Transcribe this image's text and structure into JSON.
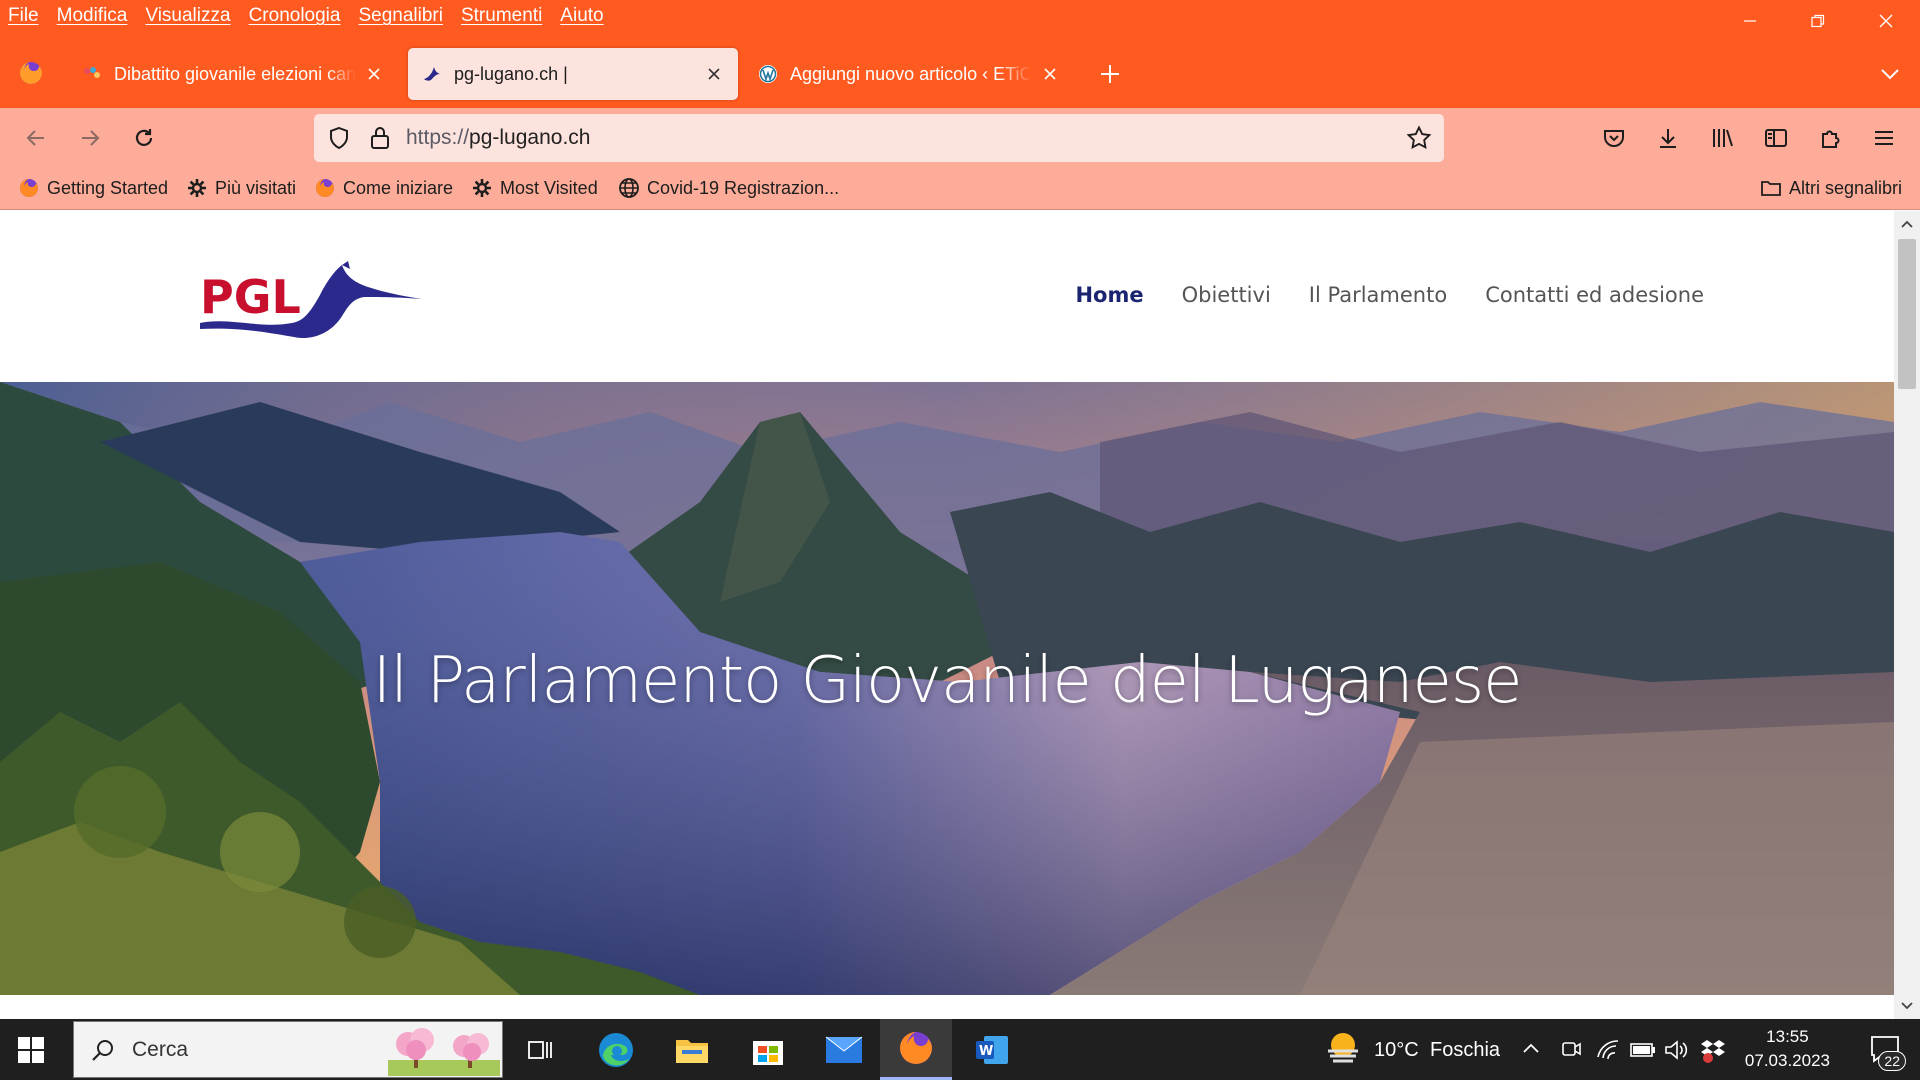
{
  "menubar": {
    "items": [
      "File",
      "Modifica",
      "Visualizza",
      "Cronologia",
      "Segnalibri",
      "Strumenti",
      "Aiuto"
    ]
  },
  "tabs": [
    {
      "title": "Dibattito giovanile elezioni cant",
      "favicon": "colorful-dots-icon",
      "active": false
    },
    {
      "title": "pg-lugano.ch |",
      "favicon": "pgl-logo-icon",
      "active": true
    },
    {
      "title": "Aggiungi nuovo articolo ‹ ETiCi",
      "favicon": "wordpress-icon",
      "active": false
    }
  ],
  "urlbar": {
    "scheme": "https://",
    "host": "pg-lugano.ch"
  },
  "bookmarks": {
    "items": [
      {
        "label": "Getting Started",
        "icon": "firefox-icon"
      },
      {
        "label": "Più visitati",
        "icon": "gear-icon"
      },
      {
        "label": "Come iniziare",
        "icon": "firefox-icon"
      },
      {
        "label": "Most Visited",
        "icon": "gear-icon"
      },
      {
        "label": "Covid-19 Registrazion...",
        "icon": "globe-icon"
      }
    ],
    "other": "Altri segnalibri"
  },
  "site": {
    "logo_text": "PGL",
    "nav": [
      {
        "label": "Home",
        "active": true
      },
      {
        "label": "Obiettivi",
        "active": false
      },
      {
        "label": "Il Parlamento",
        "active": false
      },
      {
        "label": "Contatti ed adesione",
        "active": false
      }
    ],
    "hero_title": "Il Parlamento Giovanile del Luganese"
  },
  "taskbar": {
    "search_placeholder": "Cerca",
    "weather_temp": "10°C",
    "weather_desc": "Foschia",
    "time": "13:55",
    "date": "07.03.2023",
    "notifications": "22"
  },
  "colors": {
    "chrome_orange": "#ff5a1f",
    "toolbar_salmon": "#fcac99",
    "active_tab": "#fde3dd",
    "logo_red": "#c8102e",
    "logo_blue": "#2b2a8c",
    "nav_active": "#1b2470"
  }
}
